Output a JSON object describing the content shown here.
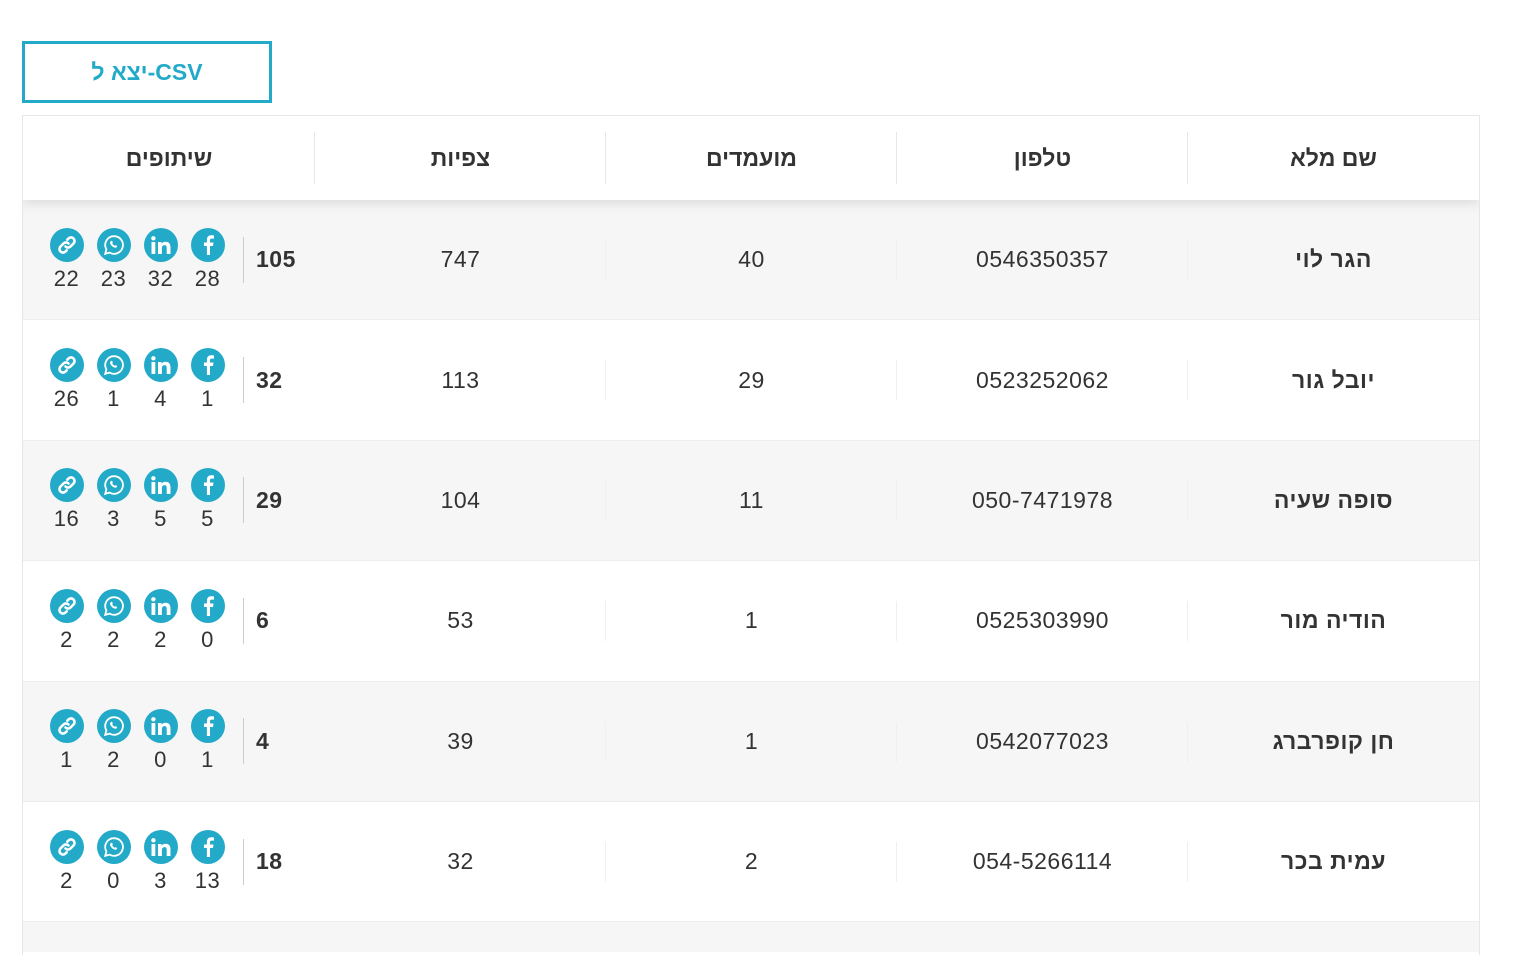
{
  "export_button": {
    "label": "יצא ל-CSV"
  },
  "table": {
    "headers": {
      "name": "שם מלא",
      "phone": "טלפון",
      "candidates": "מועמדים",
      "views": "צפיות",
      "shares": "שיתופים"
    },
    "share_icons": [
      "facebook-icon",
      "linkedin-icon",
      "whatsapp-icon",
      "link-icon"
    ],
    "rows": [
      {
        "name": "הגר לוי",
        "phone": "0546350357",
        "candidates": "40",
        "views": "747",
        "total": "105",
        "facebook": "28",
        "linkedin": "32",
        "whatsapp": "23",
        "link": "22"
      },
      {
        "name": "יובל גור",
        "phone": "0523252062",
        "candidates": "29",
        "views": "113",
        "total": "32",
        "facebook": "1",
        "linkedin": "4",
        "whatsapp": "1",
        "link": "26"
      },
      {
        "name": "סופה שעיה",
        "phone": "050-7471978",
        "candidates": "11",
        "views": "104",
        "total": "29",
        "facebook": "5",
        "linkedin": "5",
        "whatsapp": "3",
        "link": "16"
      },
      {
        "name": "הודיה מור",
        "phone": "0525303990",
        "candidates": "1",
        "views": "53",
        "total": "6",
        "facebook": "0",
        "linkedin": "2",
        "whatsapp": "2",
        "link": "2"
      },
      {
        "name": "חן קופרברג",
        "phone": "0542077023",
        "candidates": "1",
        "views": "39",
        "total": "4",
        "facebook": "1",
        "linkedin": "0",
        "whatsapp": "2",
        "link": "1"
      },
      {
        "name": "עמית בכר",
        "phone": "054-5266114",
        "candidates": "2",
        "views": "32",
        "total": "18",
        "facebook": "13",
        "linkedin": "3",
        "whatsapp": "0",
        "link": "2"
      }
    ]
  },
  "colors": {
    "accent": "#22aac8",
    "text": "#333333",
    "row_alt": "#f6f6f6"
  }
}
